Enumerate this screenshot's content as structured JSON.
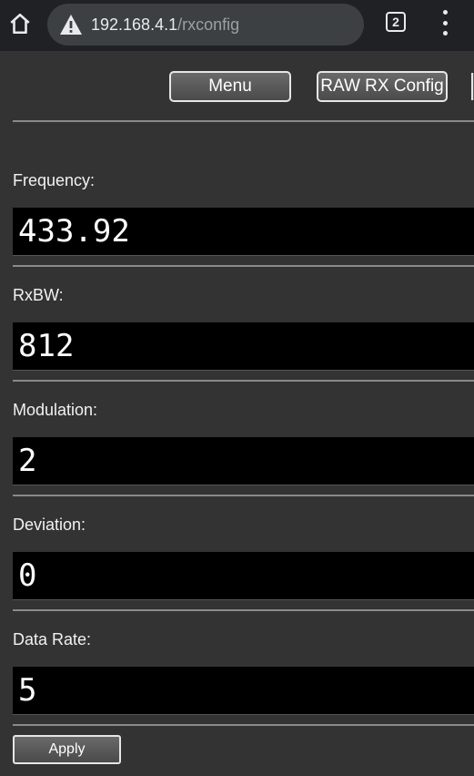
{
  "browser": {
    "url_host": "192.168.4.1",
    "url_path": "/rxconfig",
    "tab_count": "2",
    "icons": {
      "home": "home-icon",
      "warning": "warning-icon",
      "tabs": "tab-switcher-icon",
      "overflow": "more-vert-icon"
    }
  },
  "nav": {
    "menu_label": "Menu",
    "raw_rx_config_label": "RAW RX Config"
  },
  "fields": [
    {
      "label": "Frequency:",
      "value": "433.92"
    },
    {
      "label": "RxBW:",
      "value": "812"
    },
    {
      "label": "Modulation:",
      "value": "2"
    },
    {
      "label": "Deviation:",
      "value": "0"
    },
    {
      "label": "Data Rate:",
      "value": "5"
    }
  ],
  "apply_label": "Apply",
  "colors": {
    "page_bg": "#333333",
    "chrome_bg": "#202124",
    "input_bg": "#000000",
    "divider": "#8a8a8a"
  }
}
